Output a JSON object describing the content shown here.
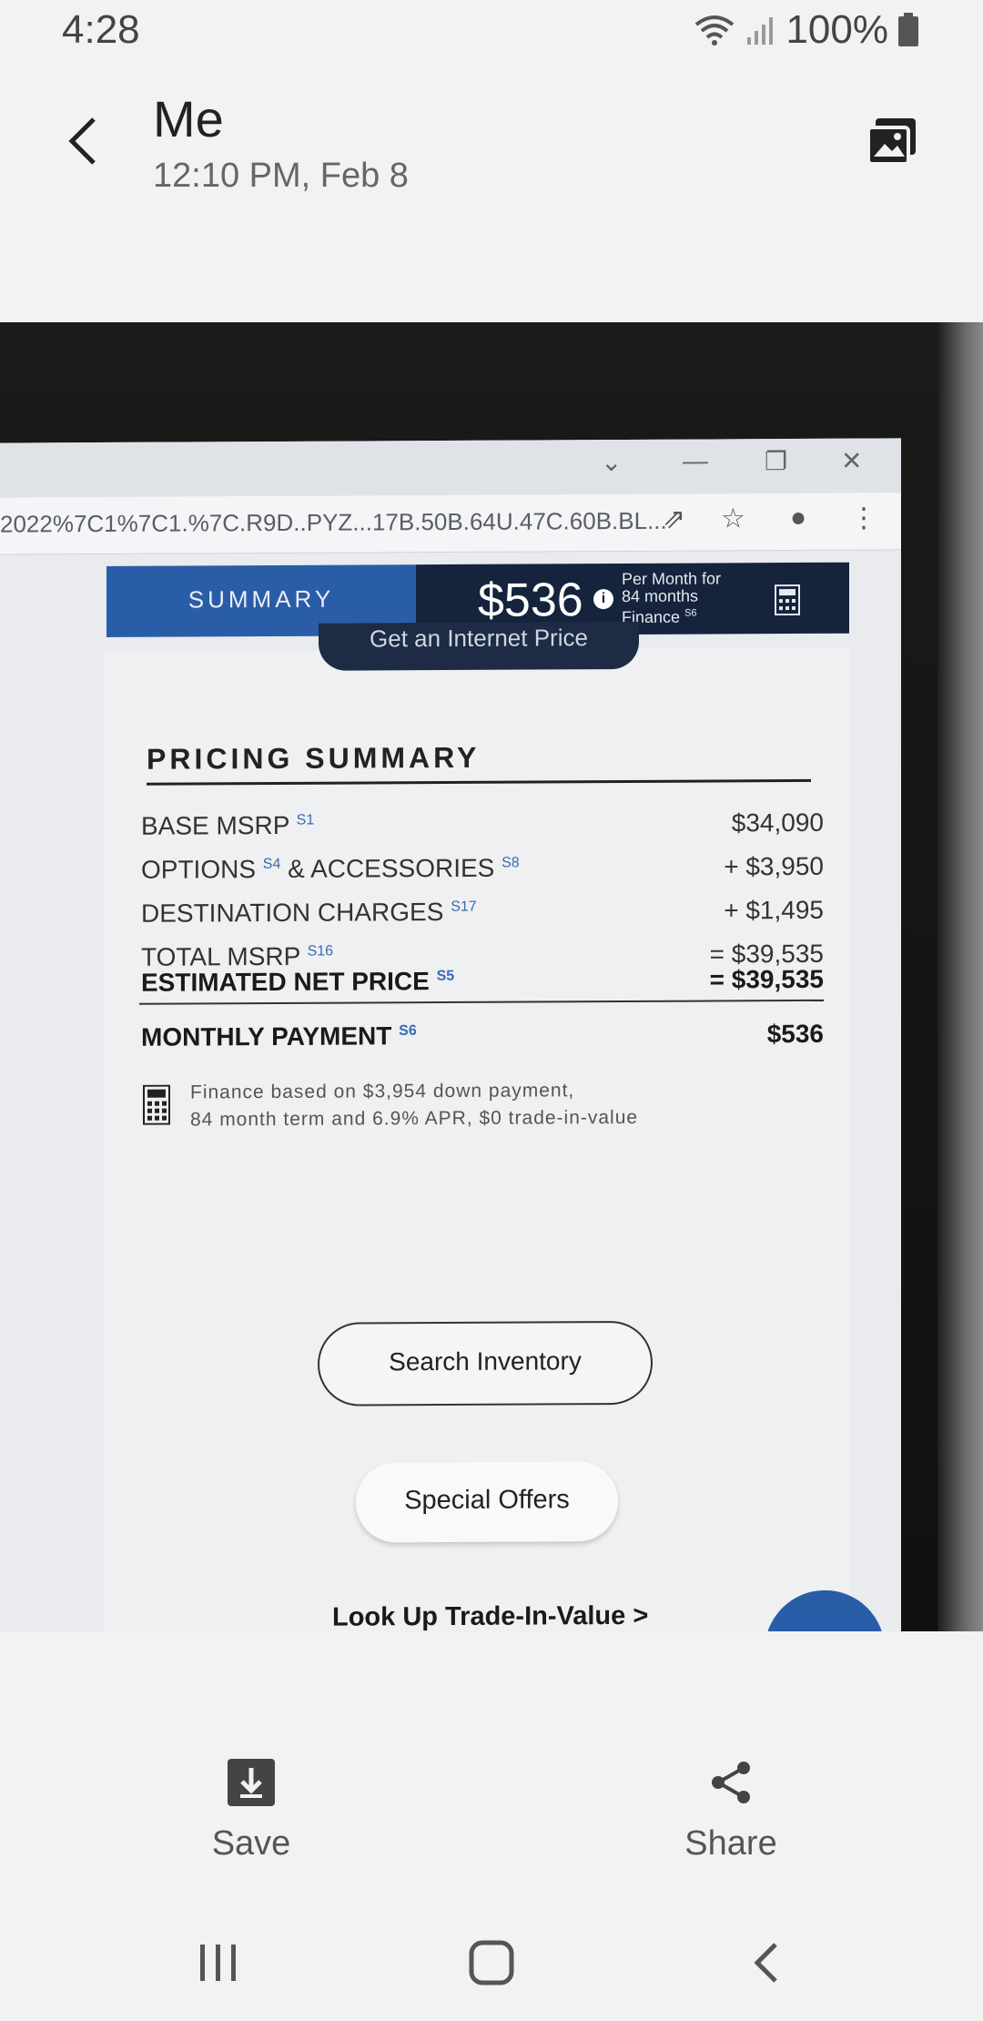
{
  "status_bar": {
    "time": "4:28",
    "battery": "100%"
  },
  "header": {
    "title": "Me",
    "subtitle": "12:10 PM, Feb 8"
  },
  "photo": {
    "browser": {
      "address_text": "2022%7C1%7C1.%7C.R9D..PYZ...17B.50B.64U.47C.60B.BL..."
    },
    "summary_tab": "SUMMARY",
    "monthly_price": "$536",
    "price_note_line1": "Per Month for",
    "price_note_line2": "84 months",
    "price_note_line3": "Finance",
    "price_note_sup": "S6",
    "internet_price_btn": "Get an Internet Price",
    "pricing_heading": "PRICING SUMMARY",
    "rows": [
      {
        "label": "BASE MSRP",
        "sup": "S1",
        "value": "$34,090"
      },
      {
        "label": "OPTIONS",
        "sup": "S4",
        "label2": " & ACCESSORIES",
        "sup2": "S8",
        "value": "+ $3,950"
      },
      {
        "label": "DESTINATION CHARGES",
        "sup": "S17",
        "value": "+ $1,495"
      },
      {
        "label": "TOTAL MSRP",
        "sup": "S16",
        "value": "= $39,535"
      },
      {
        "label": "ESTIMATED NET PRICE",
        "sup": "S5",
        "value": "= $39,535"
      },
      {
        "label": "MONTHLY PAYMENT",
        "sup": "S6",
        "value": "$536"
      }
    ],
    "finance_line1": "Finance based on $3,954 down payment,",
    "finance_line2": "84 month term and 6.9% APR, $0 trade-in-value",
    "search_inventory": "Search Inventory",
    "special_offers": "Special Offers",
    "trade_link": "Look Up Trade-In-Value >"
  },
  "actions": {
    "save": "Save",
    "share": "Share"
  }
}
